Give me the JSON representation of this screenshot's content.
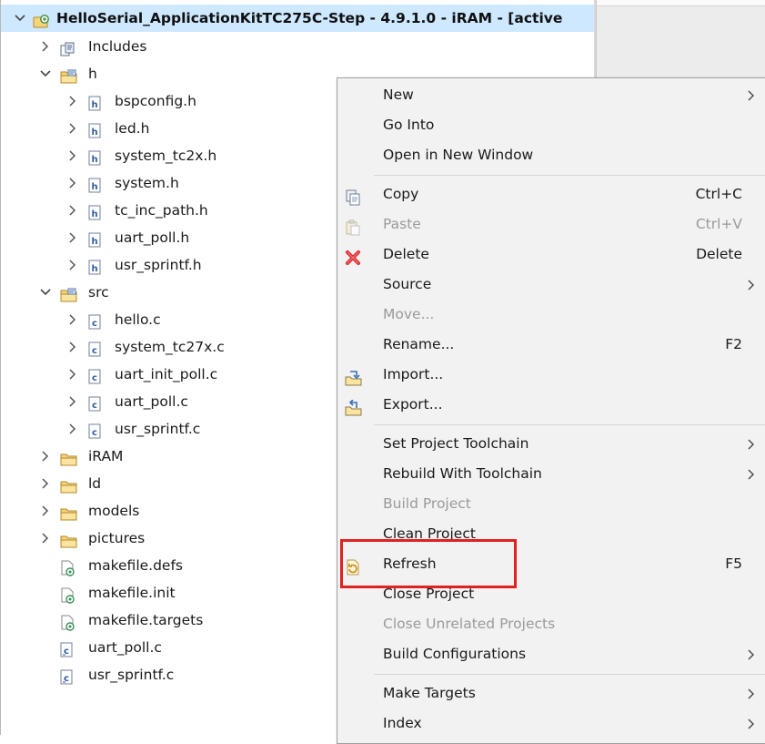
{
  "project": {
    "title": "HelloSerial_ApplicationKitTC275C-Step - 4.9.1.0 -  iRAM - [active"
  },
  "tree": [
    {
      "label": "Includes",
      "kind": "includes",
      "depth": 1,
      "expanded": false
    },
    {
      "label": "h",
      "kind": "folder-src",
      "depth": 1,
      "expanded": true
    },
    {
      "label": "bspconfig.h",
      "kind": "h",
      "depth": 2,
      "expanded": false
    },
    {
      "label": "led.h",
      "kind": "h",
      "depth": 2,
      "expanded": false
    },
    {
      "label": "system_tc2x.h",
      "kind": "h",
      "depth": 2,
      "expanded": false
    },
    {
      "label": "system.h",
      "kind": "h",
      "depth": 2,
      "expanded": false
    },
    {
      "label": "tc_inc_path.h",
      "kind": "h",
      "depth": 2,
      "expanded": false
    },
    {
      "label": "uart_poll.h",
      "kind": "h",
      "depth": 2,
      "expanded": false
    },
    {
      "label": "usr_sprintf.h",
      "kind": "h",
      "depth": 2,
      "expanded": false
    },
    {
      "label": "src",
      "kind": "folder-src",
      "depth": 1,
      "expanded": true
    },
    {
      "label": "hello.c",
      "kind": "c",
      "depth": 2,
      "expanded": false
    },
    {
      "label": "system_tc27x.c",
      "kind": "c",
      "depth": 2,
      "expanded": false
    },
    {
      "label": "uart_init_poll.c",
      "kind": "c",
      "depth": 2,
      "expanded": false
    },
    {
      "label": "uart_poll.c",
      "kind": "c",
      "depth": 2,
      "expanded": false
    },
    {
      "label": "usr_sprintf.c",
      "kind": "c",
      "depth": 2,
      "expanded": false
    },
    {
      "label": "iRAM",
      "kind": "folder",
      "depth": 1,
      "expanded": false
    },
    {
      "label": "ld",
      "kind": "folder",
      "depth": 1,
      "expanded": false
    },
    {
      "label": "models",
      "kind": "folder",
      "depth": 1,
      "expanded": false
    },
    {
      "label": "pictures",
      "kind": "folder",
      "depth": 1,
      "expanded": false
    },
    {
      "label": "makefile.defs",
      "kind": "make",
      "depth": 1,
      "expanded": null
    },
    {
      "label": "makefile.init",
      "kind": "make",
      "depth": 1,
      "expanded": null
    },
    {
      "label": "makefile.targets",
      "kind": "make",
      "depth": 1,
      "expanded": null
    },
    {
      "label": "uart_poll.c",
      "kind": "c-link",
      "depth": 1,
      "expanded": null
    },
    {
      "label": "usr_sprintf.c",
      "kind": "c-link",
      "depth": 1,
      "expanded": null
    }
  ],
  "menu": {
    "items": [
      {
        "id": "new",
        "label": "New",
        "shortcut": "",
        "submenu": true,
        "disabled": false,
        "icon": ""
      },
      {
        "id": "go-into",
        "label": "Go Into",
        "shortcut": "",
        "submenu": false,
        "disabled": false,
        "icon": ""
      },
      {
        "id": "open-new-window",
        "label": "Open in New Window",
        "shortcut": "",
        "submenu": false,
        "disabled": false,
        "icon": "",
        "sep_after": true
      },
      {
        "id": "copy",
        "label": "Copy",
        "shortcut": "Ctrl+C",
        "submenu": false,
        "disabled": false,
        "icon": "copy-icon"
      },
      {
        "id": "paste",
        "label": "Paste",
        "shortcut": "Ctrl+V",
        "submenu": false,
        "disabled": true,
        "icon": "paste-icon"
      },
      {
        "id": "delete",
        "label": "Delete",
        "shortcut": "Delete",
        "submenu": false,
        "disabled": false,
        "icon": "delete-icon"
      },
      {
        "id": "source",
        "label": "Source",
        "shortcut": "",
        "submenu": true,
        "disabled": false,
        "icon": ""
      },
      {
        "id": "move",
        "label": "Move...",
        "shortcut": "",
        "submenu": false,
        "disabled": true,
        "icon": ""
      },
      {
        "id": "rename",
        "label": "Rename...",
        "shortcut": "F2",
        "submenu": false,
        "disabled": false,
        "icon": ""
      },
      {
        "id": "import",
        "label": "Import...",
        "shortcut": "",
        "submenu": false,
        "disabled": false,
        "icon": "import-icon"
      },
      {
        "id": "export",
        "label": "Export...",
        "shortcut": "",
        "submenu": false,
        "disabled": false,
        "icon": "export-icon",
        "sep_after": true
      },
      {
        "id": "set-toolchain",
        "label": "Set Project Toolchain",
        "shortcut": "",
        "submenu": true,
        "disabled": false,
        "icon": ""
      },
      {
        "id": "rebuild-toolchain",
        "label": "Rebuild With Toolchain",
        "shortcut": "",
        "submenu": true,
        "disabled": false,
        "icon": ""
      },
      {
        "id": "build-project",
        "label": "Build Project",
        "shortcut": "",
        "submenu": false,
        "disabled": true,
        "icon": ""
      },
      {
        "id": "clean-project",
        "label": "Clean Project",
        "shortcut": "",
        "submenu": false,
        "disabled": false,
        "icon": ""
      },
      {
        "id": "refresh",
        "label": "Refresh",
        "shortcut": "F5",
        "submenu": false,
        "disabled": false,
        "icon": "refresh-icon"
      },
      {
        "id": "close-project",
        "label": "Close Project",
        "shortcut": "",
        "submenu": false,
        "disabled": false,
        "icon": ""
      },
      {
        "id": "close-unrelated",
        "label": "Close Unrelated Projects",
        "shortcut": "",
        "submenu": false,
        "disabled": true,
        "icon": ""
      },
      {
        "id": "build-configs",
        "label": "Build Configurations",
        "shortcut": "",
        "submenu": true,
        "disabled": false,
        "icon": "",
        "sep_after": true
      },
      {
        "id": "make-targets",
        "label": "Make Targets",
        "shortcut": "",
        "submenu": true,
        "disabled": false,
        "icon": ""
      },
      {
        "id": "index",
        "label": "Index",
        "shortcut": "",
        "submenu": true,
        "disabled": false,
        "icon": ""
      }
    ]
  },
  "highlight": {
    "target": "refresh",
    "color": "#e0211f"
  },
  "glyphs": {
    "chev_right": "›",
    "chev_down": "⌄",
    "submenu": "›",
    "h_file": "h",
    "c_file": "c"
  }
}
